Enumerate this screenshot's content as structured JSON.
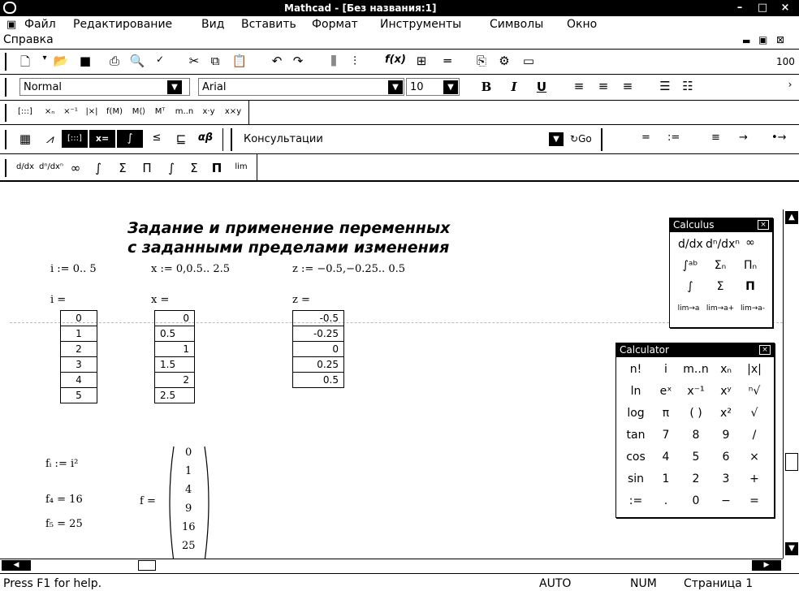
{
  "window": {
    "title": "Mathcad - [Без названия:1]"
  },
  "menu": [
    "Файл",
    "Редактирование",
    "Вид",
    "Вставить",
    "Формат",
    "Инструменты",
    "Символы",
    "Окно",
    "Справка"
  ],
  "format_bar": {
    "style": "Normal",
    "font": "Arial",
    "size": "10",
    "bold": "B",
    "italic": "I",
    "underline": "U"
  },
  "zoom": "100",
  "resources_bar": {
    "label": "Консультации",
    "go": "Go"
  },
  "math_toolbar": {
    "ops": [
      "=",
      ":=",
      "≡",
      "→",
      "•→"
    ]
  },
  "worksheet": {
    "heading_line1": "Задание и применение переменных",
    "heading_line2": "с заданными пределами изменения",
    "defs": {
      "i": "i := 0.. 5",
      "x": "x := 0,0.5.. 2.5",
      "z": "z := −0.5,−0.25.. 0.5"
    },
    "labels": {
      "i": "i =",
      "x": "x =",
      "z": "z ="
    },
    "i_values": [
      "0",
      "1",
      "2",
      "3",
      "4",
      "5"
    ],
    "x_values": [
      "0",
      "0.5",
      "1",
      "1.5",
      "2",
      "2.5"
    ],
    "z_values": [
      "-0.5",
      "-0.25",
      "0",
      "0.25",
      "0.5"
    ],
    "f_def": "fᵢ := i²",
    "f_eval_label": "f =",
    "f_vector": [
      "0",
      "1",
      "4",
      "9",
      "16",
      "25"
    ],
    "f4": "f₄ = 16",
    "f5": "f₅ = 25"
  },
  "calculus_panel": {
    "title": "Calculus",
    "cells": [
      "d/dx",
      "dⁿ/dxⁿ",
      "∞",
      "∫ᵃᵇ",
      "Σₙ",
      "Πₙ",
      "∫",
      "Σ",
      "Π",
      "lim→a",
      "lim→a+",
      "lim→a-"
    ]
  },
  "calculator_panel": {
    "title": "Calculator",
    "rows": [
      [
        "n!",
        "i",
        "m..n",
        "xₙ",
        "|x|"
      ],
      [
        "ln",
        "eˣ",
        "x⁻¹",
        "xʸ",
        "ⁿ√"
      ],
      [
        "log",
        "π",
        "( )",
        "x²",
        "√"
      ],
      [
        "tan",
        "7",
        "8",
        "9",
        "/"
      ],
      [
        "cos",
        "4",
        "5",
        "6",
        "×"
      ],
      [
        "sin",
        "1",
        "2",
        "3",
        "+"
      ],
      [
        ":=",
        ".",
        "0",
        "−",
        "="
      ]
    ]
  },
  "status": {
    "help": "Press F1 for help.",
    "mode": "AUTO",
    "num": "NUM",
    "page": "Страница 1"
  }
}
